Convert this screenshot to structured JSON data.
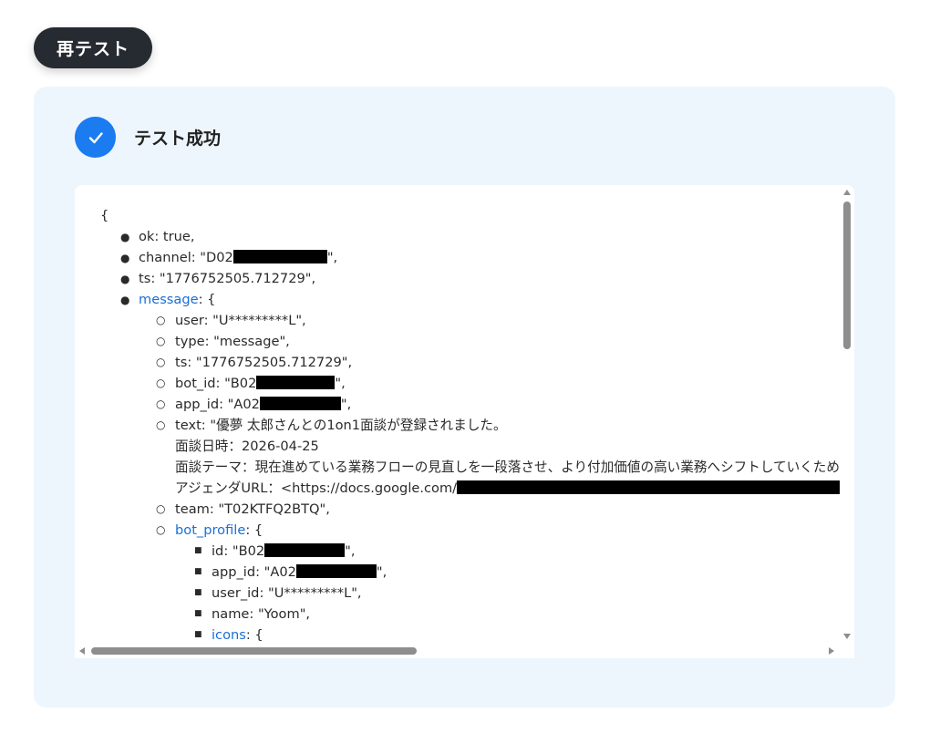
{
  "toolbar": {
    "retest_label": "再テスト"
  },
  "status": {
    "label": "テスト成功",
    "icon": "check-icon",
    "color": "#1a7cf0"
  },
  "json_view": {
    "open_brace": "{",
    "lines": {
      "ok": "ok: true,",
      "channel_prefix": "channel: \"D02",
      "channel_suffix": "\",",
      "ts": "ts: \"1776752505.712729\",",
      "message_key": "message",
      "message_open": ": {",
      "user": "user: \"U*********L\",",
      "type": "type: \"message\",",
      "msg_ts": "ts: \"1776752505.712729\",",
      "bot_id_prefix": "bot_id: \"B02",
      "bot_id_suffix": "\",",
      "app_id_prefix": "app_id: \"A02",
      "app_id_suffix": "\",",
      "text_1": "text: \"優夢 太郎さんとの1on1面談が登録されました。",
      "text_2": "面談日時：2026-04-25",
      "text_3": "面談テーマ：現在進めている業務フローの見直しを一段落させ、より付加価値の高い業務へシフトしていくため",
      "text_4_prefix": "アジェンダURL：<https://docs.google.com/",
      "team": "team: \"T02KTFQ2BTQ\",",
      "bot_profile_key": "bot_profile",
      "bot_profile_open": ": {",
      "bp_id_prefix": "id: \"B02",
      "bp_id_suffix": "\",",
      "bp_app_id_prefix": "app_id: \"A02",
      "bp_app_id_suffix": "\",",
      "bp_user_id": "user_id: \"U*********L\",",
      "bp_name": "name: \"Yoom\",",
      "icons_key": "icons",
      "icons_open": ": {"
    }
  }
}
